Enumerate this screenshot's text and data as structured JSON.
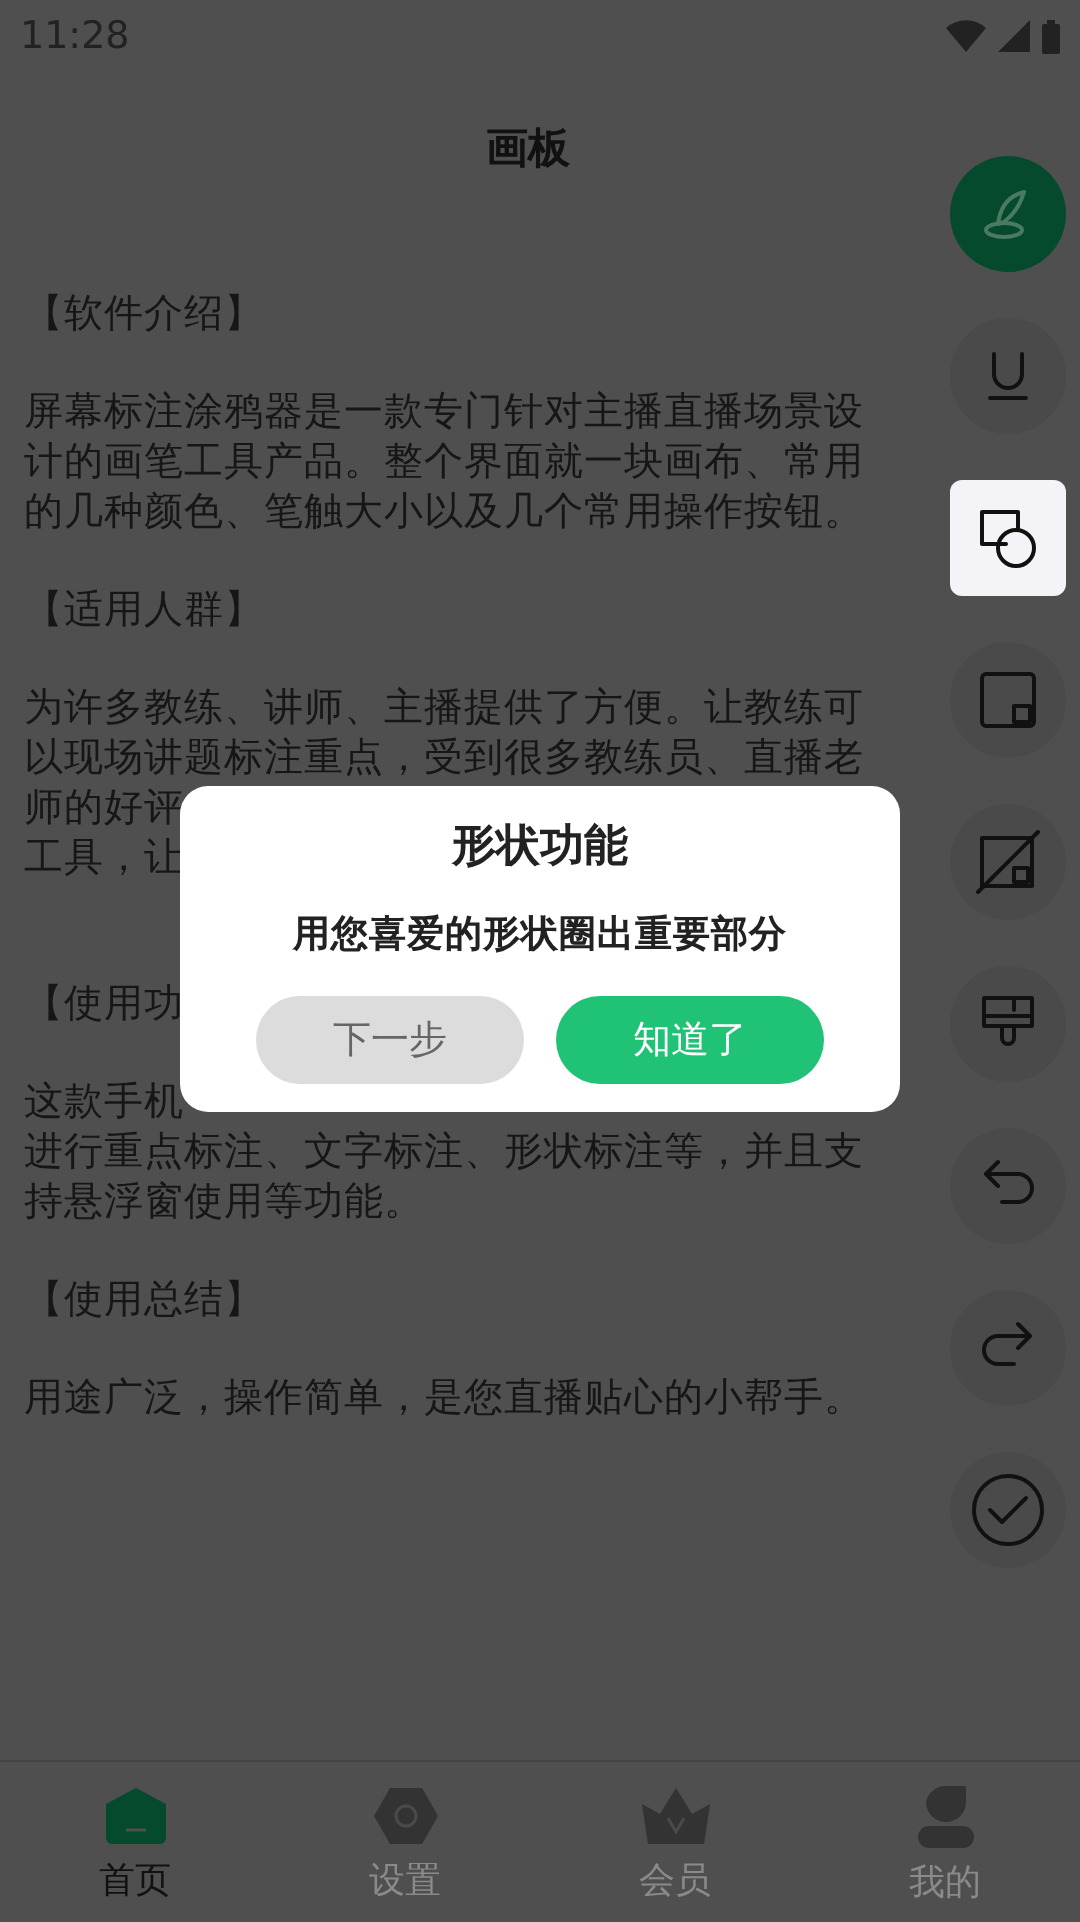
{
  "status_bar": {
    "time": "11:28"
  },
  "title": "画板",
  "lines": [
    {
      "kind": "heading",
      "text": "【软件介绍】"
    },
    {
      "kind": "gap"
    },
    {
      "kind": "text",
      "text": "屏幕标注涂鸦器是一款专门针对主播直播场景设"
    },
    {
      "kind": "text",
      "text": "计的画笔工具产品。整个界面就一块画布、常用"
    },
    {
      "kind": "text",
      "text": "的几种颜色、笔触大小以及几个常用操作按钮。"
    },
    {
      "kind": "gap"
    },
    {
      "kind": "heading",
      "text": "【适用人群】"
    },
    {
      "kind": "gap"
    },
    {
      "kind": "text",
      "text": "为许多教练、讲师、主播提供了方便。让教练可"
    },
    {
      "kind": "text",
      "text": "以现场讲题标注重点，受到很多教练员、直播老"
    },
    {
      "kind": "text",
      "text": "师的好评"
    },
    {
      "kind": "text",
      "text": "工具，让"
    },
    {
      "kind": "gap"
    },
    {
      "kind": "gap"
    },
    {
      "kind": "heading",
      "text": "【使用功"
    },
    {
      "kind": "gap"
    },
    {
      "kind": "text",
      "text": "这款手机"
    },
    {
      "kind": "text",
      "text": "进行重点标注、文字标注、形状标注等，并且支"
    },
    {
      "kind": "text",
      "text": "持悬浮窗使用等功能。"
    },
    {
      "kind": "gap"
    },
    {
      "kind": "heading",
      "text": "【使用总结】"
    },
    {
      "kind": "gap"
    },
    {
      "kind": "text",
      "text": "用途广泛，操作简单，是您直播贴心的小帮手。"
    }
  ],
  "toolbar": [
    {
      "kind": "pen",
      "selected": false
    },
    {
      "kind": "underline",
      "selected": false
    },
    {
      "kind": "shape",
      "selected": true
    },
    {
      "kind": "rect",
      "selected": false
    },
    {
      "kind": "erase",
      "selected": false
    },
    {
      "kind": "paint",
      "selected": false
    },
    {
      "kind": "undo",
      "selected": false
    },
    {
      "kind": "redo",
      "selected": false
    },
    {
      "kind": "done",
      "selected": false
    }
  ],
  "dialog": {
    "title": "形状功能",
    "message": "用您喜爱的形状圈出重要部分",
    "buttons": [
      {
        "kind": "secondary",
        "label": "下一步"
      },
      {
        "kind": "primary",
        "label": "知道了"
      }
    ]
  },
  "nav": [
    {
      "kind": "home",
      "label": "首页",
      "selected": true
    },
    {
      "kind": "settings",
      "label": "设置",
      "selected": false
    },
    {
      "kind": "vip",
      "label": "会员",
      "selected": false
    },
    {
      "kind": "user",
      "label": "我的",
      "selected": false
    }
  ]
}
